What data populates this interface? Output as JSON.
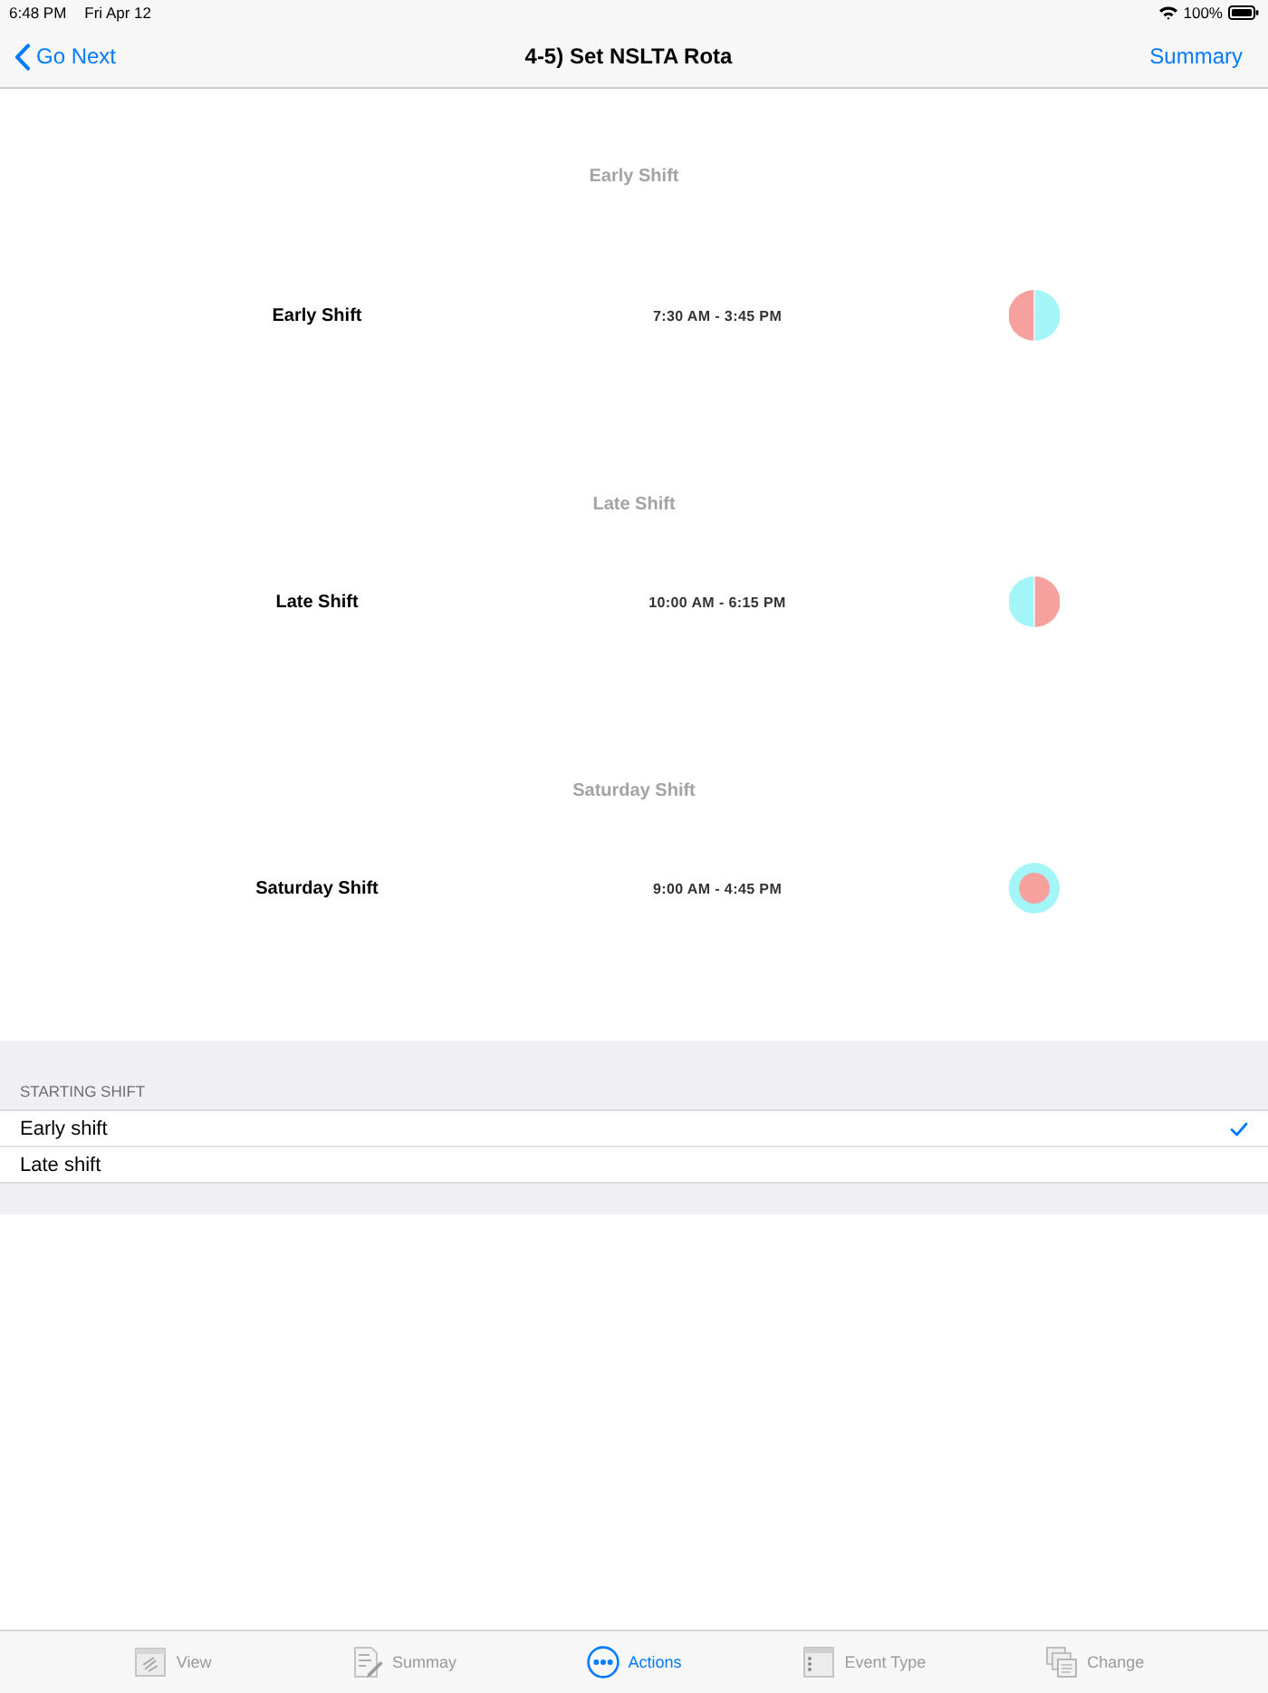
{
  "status_bar": {
    "time": "6:48 PM",
    "date": "Fri Apr 12",
    "battery": "100%"
  },
  "nav_bar": {
    "back": "Go Next",
    "title": "4-5) Set NSLTA Rota",
    "action": "Summary"
  },
  "shifts": [
    {
      "header": "Early Shift",
      "name": "Early Shift",
      "hours": "7:30 AM - 3:45 PM",
      "indicator": {
        "kind": "split",
        "parts": [
          {
            "color": "#f7a19f"
          },
          {
            "color": "#a3f5f7"
          }
        ]
      }
    },
    {
      "header": "Late Shift",
      "name": "Late Shift",
      "hours": "10:00 AM - 6:15 PM",
      "indicator": {
        "kind": "split",
        "parts": [
          {
            "color": "#a3f5f7"
          },
          {
            "color": "#f7a19f"
          }
        ]
      }
    },
    {
      "header": "Saturday Shift",
      "name": "Saturday Shift",
      "hours": "9:00 AM - 4:45 PM",
      "indicator": {
        "kind": "ring",
        "parts": [
          {
            "color": "#a3f5f7"
          },
          {
            "color": "#f7a19f"
          }
        ]
      }
    }
  ],
  "starting_shift": {
    "header": "STARTING SHIFT",
    "options": [
      {
        "label": "Early shift",
        "selected": true
      },
      {
        "label": "Late shift",
        "selected": false
      }
    ]
  },
  "tab_bar": [
    {
      "label": "View",
      "kind": "view",
      "selected": false
    },
    {
      "label": "Summay",
      "kind": "summary",
      "selected": false
    },
    {
      "label": "Actions",
      "kind": "actions",
      "selected": true
    },
    {
      "label": "Event Type",
      "kind": "event_type",
      "selected": false
    },
    {
      "label": "Change",
      "kind": "change",
      "selected": false
    }
  ]
}
